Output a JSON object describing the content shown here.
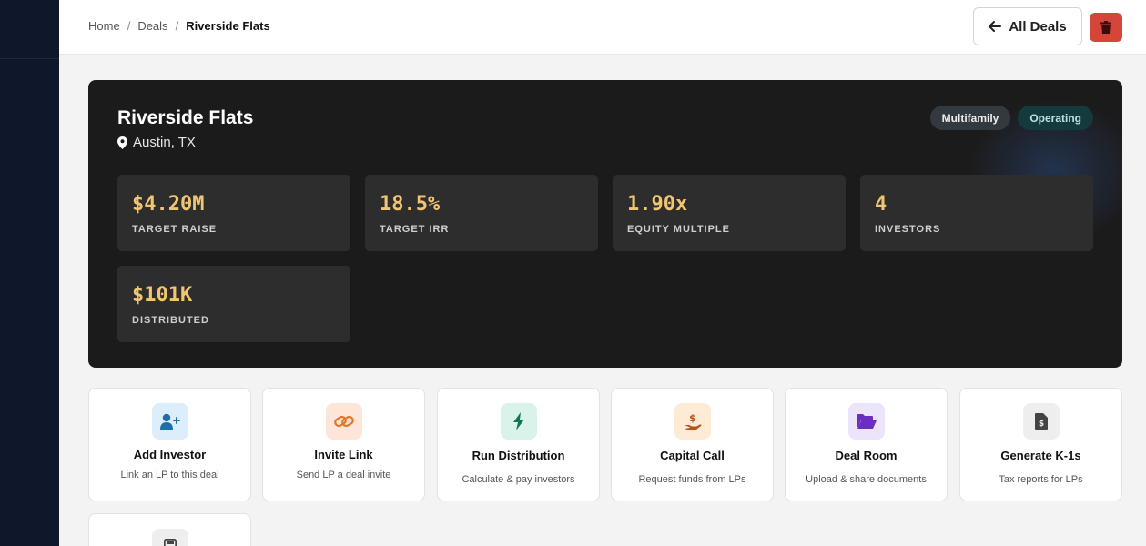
{
  "breadcrumb": {
    "home": "Home",
    "deals": "Deals",
    "current": "Riverside Flats",
    "separator": "/"
  },
  "header": {
    "back_label": "All Deals"
  },
  "deal": {
    "name": "Riverside Flats",
    "location": "Austin, TX",
    "tags": {
      "type": "Multifamily",
      "status": "Operating"
    },
    "stats": [
      {
        "value": "$4.20M",
        "label": "TARGET RAISE"
      },
      {
        "value": "18.5%",
        "label": "TARGET IRR"
      },
      {
        "value": "1.90x",
        "label": "EQUITY MULTIPLE"
      },
      {
        "value": "4",
        "label": "INVESTORS"
      },
      {
        "value": "$101K",
        "label": "DISTRIBUTED"
      }
    ]
  },
  "actions": [
    {
      "title": "Add Investor",
      "subtitle": "Link an LP to this deal",
      "icon": "user-plus-icon",
      "bg": "#dcedfb",
      "fg": "#1d6fa5"
    },
    {
      "title": "Invite Link",
      "subtitle": "Send LP a deal invite",
      "icon": "link-icon",
      "bg": "#fde6d8",
      "fg": "#e8742c"
    },
    {
      "title": "Run Distribution",
      "subtitle": "Calculate & pay investors",
      "icon": "bolt-icon",
      "bg": "#d9f3ea",
      "fg": "#137552"
    },
    {
      "title": "Capital Call",
      "subtitle": "Request funds from LPs",
      "icon": "hand-dollar-icon",
      "bg": "#fdebd6",
      "fg": "#b4541a"
    },
    {
      "title": "Deal Room",
      "subtitle": "Upload & share documents",
      "icon": "folder-open-icon",
      "bg": "#ece4fb",
      "fg": "#6a2fc0"
    },
    {
      "title": "Generate K-1s",
      "subtitle": "Tax reports for LPs",
      "icon": "file-invoice-dollar-icon",
      "bg": "#eeeeee",
      "fg": "#444444"
    },
    {
      "title": "",
      "subtitle": "",
      "icon": "calculator-icon",
      "bg": "#eeeeee",
      "fg": "#444444"
    }
  ],
  "colors": {
    "accent_value": "#f2c572",
    "danger": "#d6453a",
    "sidebar": "#0f172a"
  }
}
